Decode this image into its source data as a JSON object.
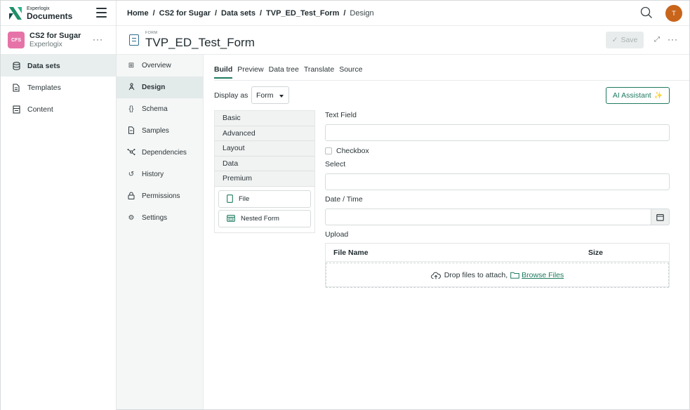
{
  "brand": {
    "small": "Experlogix",
    "big": "Documents"
  },
  "project": {
    "initials": "CFS",
    "name": "CS2 for Sugar",
    "org": "Experlogix"
  },
  "sidebar": {
    "items": [
      {
        "label": "Data sets"
      },
      {
        "label": "Templates"
      },
      {
        "label": "Content"
      }
    ]
  },
  "breadcrumb": {
    "items": [
      "Home",
      "CS2 for Sugar",
      "Data sets",
      "TVP_ED_Test_Form",
      "Design"
    ],
    "separator": "/"
  },
  "user": {
    "initial": "T"
  },
  "header": {
    "kicker": "FORM",
    "title": "TVP_ED_Test_Form",
    "save_label": "Save"
  },
  "subnav": {
    "items": [
      {
        "label": "Overview"
      },
      {
        "label": "Design"
      },
      {
        "label": "Schema"
      },
      {
        "label": "Samples"
      },
      {
        "label": "Dependencies"
      },
      {
        "label": "History"
      },
      {
        "label": "Permissions"
      },
      {
        "label": "Settings"
      }
    ]
  },
  "tabs": [
    "Build",
    "Preview",
    "Data tree",
    "Translate",
    "Source"
  ],
  "display": {
    "label": "Display as",
    "value": "Form"
  },
  "ai_button": {
    "label": "AI Assistant"
  },
  "palette": {
    "groups": [
      "Basic",
      "Advanced",
      "Layout",
      "Data",
      "Premium"
    ],
    "components": [
      "File",
      "Nested Form"
    ]
  },
  "form": {
    "text_field_label": "Text Field",
    "checkbox_label": "Checkbox",
    "select_label": "Select",
    "datetime_label": "Date / Time",
    "upload_label": "Upload",
    "upload_col_name": "File Name",
    "upload_col_size": "Size",
    "drop_text": "Drop files to attach,",
    "browse_text": "Browse Files"
  },
  "colors": {
    "accent": "#1e7a5f",
    "project_badge": "#e673a8",
    "user_avatar": "#c8651b",
    "form_icon": "#2f6c8f"
  }
}
